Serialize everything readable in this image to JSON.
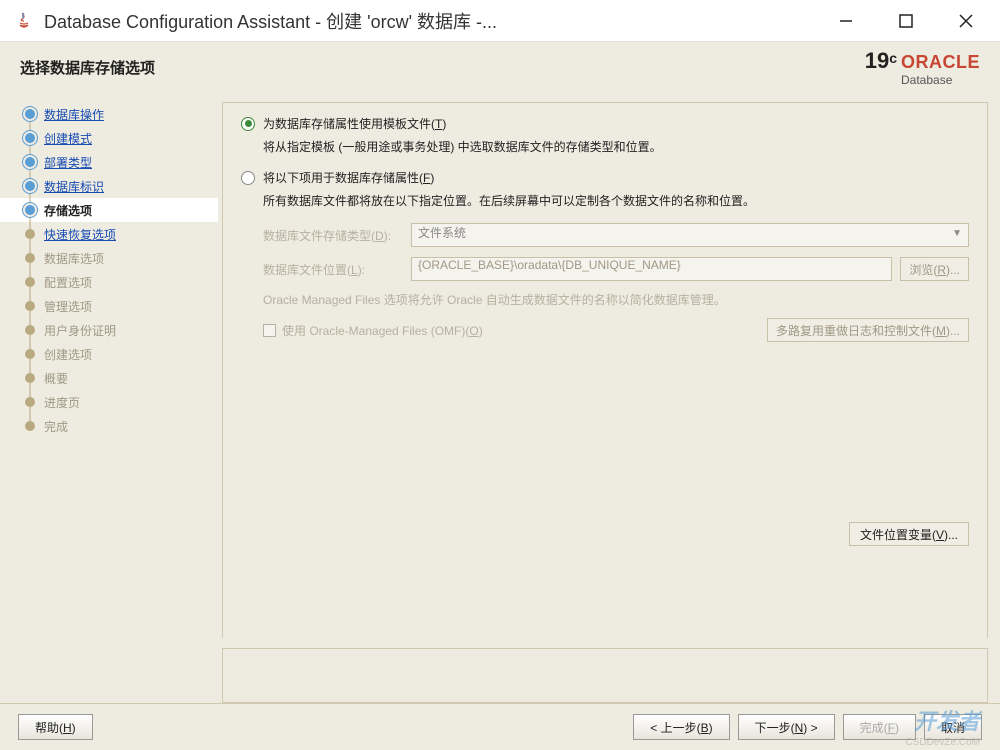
{
  "titlebar": {
    "title": "Database Configuration Assistant - 创建 'orcw' 数据库 -..."
  },
  "header": {
    "title": "选择数据库存储选项",
    "logo_version": "19",
    "logo_suffix": "c",
    "logo_brand": "ORACLE",
    "logo_product": "Database"
  },
  "sidebar": {
    "steps": [
      {
        "label": "数据库操作",
        "state": "completed"
      },
      {
        "label": "创建模式",
        "state": "completed"
      },
      {
        "label": "部署类型",
        "state": "completed"
      },
      {
        "label": "数据库标识",
        "state": "completed"
      },
      {
        "label": "存储选项",
        "state": "current"
      },
      {
        "label": "快速恢复选项",
        "state": "next"
      },
      {
        "label": "数据库选项",
        "state": "disabled"
      },
      {
        "label": "配置选项",
        "state": "disabled"
      },
      {
        "label": "管理选项",
        "state": "disabled"
      },
      {
        "label": "用户身份证明",
        "state": "disabled"
      },
      {
        "label": "创建选项",
        "state": "disabled"
      },
      {
        "label": "概要",
        "state": "disabled"
      },
      {
        "label": "进度页",
        "state": "disabled"
      },
      {
        "label": "完成",
        "state": "disabled"
      }
    ]
  },
  "main": {
    "option1": {
      "label_pre": "为数据库存储属性使用模板文件(",
      "label_key": "T",
      "label_post": ")",
      "desc": "将从指定模板 (一般用途或事务处理) 中选取数据库文件的存储类型和位置。"
    },
    "option2": {
      "label_pre": "将以下项用于数据库存储属性(",
      "label_key": "F",
      "label_post": ")",
      "desc": "所有数据库文件都将放在以下指定位置。在后续屏幕中可以定制各个数据文件的名称和位置。"
    },
    "storage_type": {
      "label_pre": "数据库文件存储类型(",
      "label_key": "D",
      "label_post": "):",
      "value": "文件系统"
    },
    "file_location": {
      "label_pre": "数据库文件位置(",
      "label_key": "L",
      "label_post": "):",
      "value": "{ORACLE_BASE}\\oradata\\{DB_UNIQUE_NAME}",
      "browse_pre": "浏览(",
      "browse_key": "R",
      "browse_post": ")..."
    },
    "omf": {
      "desc": "Oracle Managed Files 选项将允许 Oracle 自动生成数据文件的名称以简化数据库管理。",
      "checkbox_pre": "使用 Oracle-Managed Files (OMF)(",
      "checkbox_key": "O",
      "checkbox_post": ")",
      "multiplex_pre": "多路复用重做日志和控制文件(",
      "multiplex_key": "M",
      "multiplex_post": ")..."
    },
    "vars_btn_pre": "文件位置变量(",
    "vars_btn_key": "V",
    "vars_btn_post": ")..."
  },
  "footer": {
    "help_pre": "帮助(",
    "help_key": "H",
    "help_post": ")",
    "back_pre": "< 上一步(",
    "back_key": "B",
    "back_post": ")",
    "next_pre": "下一步(",
    "next_key": "N",
    "next_post": ") >",
    "finish_pre": "完成(",
    "finish_key": "F",
    "finish_post": ")",
    "cancel": "取消"
  },
  "watermark": "开发者",
  "watermark2": "CSDDevZe.CoM"
}
